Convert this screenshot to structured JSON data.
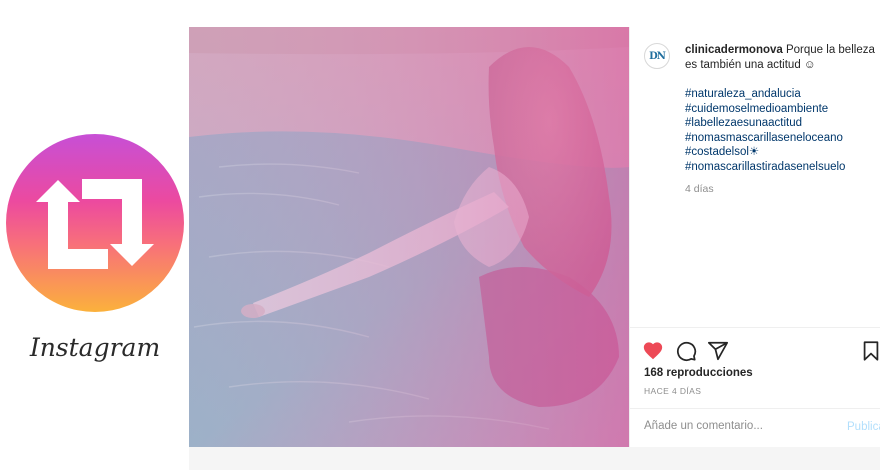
{
  "badge": {
    "icon": "repost-icon",
    "wordmark": "Instagram"
  },
  "post": {
    "username": "clinicadermonova",
    "avatar_initials": "DN",
    "caption": " Porque la belleza es también una actitud ☺",
    "hashtags": [
      "#naturaleza_andalucia",
      "#cuidemoselmedioambiente",
      "#labellezaesunaactitud",
      "#nomasmascarillaseneloceano",
      "#costadelsol☀",
      "#nomascarillastiradasenelsuelo"
    ],
    "time_ago": "4 días",
    "views": "168 reproducciones",
    "posted": "HACE 4 DÍAS",
    "comment_placeholder": "Añade un comentario...",
    "publish_label": "Publicar"
  },
  "colors": {
    "like": "#ed4956",
    "hashtag": "#00376b",
    "muted": "#8e8e8e",
    "publish": "#b2dffc"
  }
}
